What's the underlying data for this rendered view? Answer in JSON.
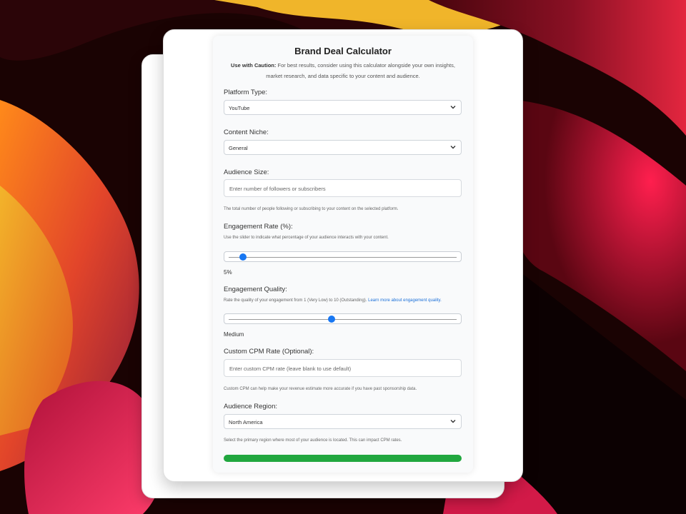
{
  "app": {
    "title": "Brand Deal Calculator",
    "caution_label": "Use with Caution:",
    "caution_text": "For best results, consider using this calculator alongside your own insights, market research, and data specific to your content and audience."
  },
  "form": {
    "platform": {
      "label": "Platform Type:",
      "value": "YouTube"
    },
    "niche": {
      "label": "Content Niche:",
      "value": "General"
    },
    "audience_size": {
      "label": "Audience Size:",
      "placeholder": "Enter number of followers or subscribers",
      "help": "The total number of people following or subscribing to your content on the selected platform."
    },
    "engagement_rate": {
      "label": "Engagement Rate (%):",
      "help": "Use the slider to indicate what percentage of your audience interacts with your content.",
      "value_text": "5%",
      "slider_fraction": 0.063
    },
    "engagement_quality": {
      "label": "Engagement Quality:",
      "help": "Rate the quality of your engagement from 1 (Very Low) to 10 (Outstanding).",
      "help_link": "Learn more about engagement quality.",
      "value_text": "Medium",
      "slider_fraction": 0.45
    },
    "custom_cpm": {
      "label": "Custom CPM Rate (Optional):",
      "placeholder": "Enter custom CPM rate (leave blank to use default)",
      "help": "Custom CPM can help make your revenue estimate more accurate if you have past sponsorship data."
    },
    "region": {
      "label": "Audience Region:",
      "value": "North America",
      "help": "Select the primary region where most of your audience is located. This can impact CPM rates."
    }
  },
  "colors": {
    "accent": "#1877f2",
    "submit": "#21a73f",
    "link": "#1a6fd8"
  }
}
